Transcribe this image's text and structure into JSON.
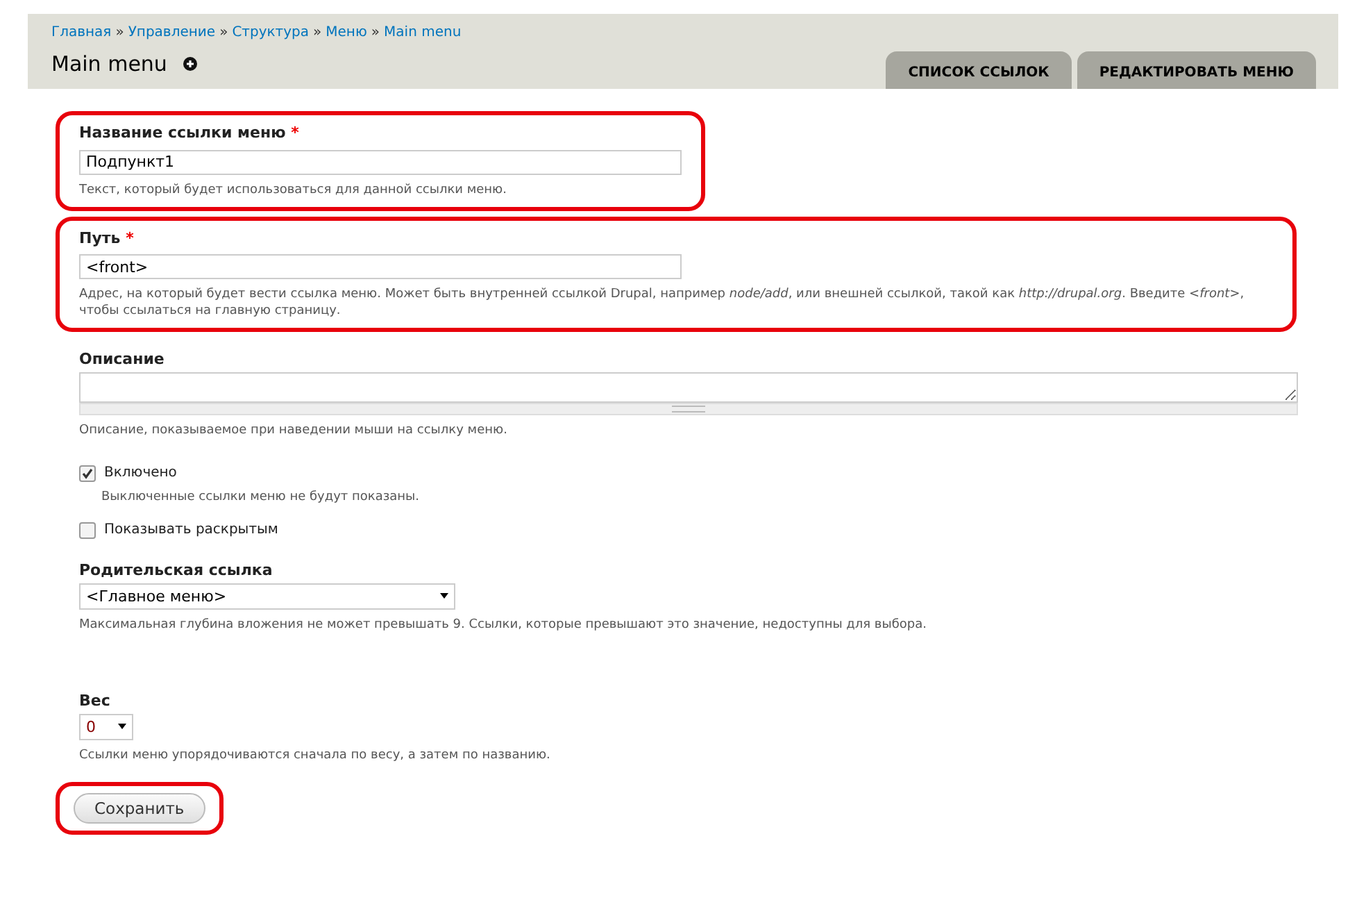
{
  "breadcrumb": [
    "Главная",
    "Управление",
    "Структура",
    "Меню",
    "Main menu"
  ],
  "breadcrumb_separator": "»",
  "page_title": "Main menu",
  "tabs": [
    {
      "label": "СПИСОК ССЫЛОК",
      "selected": false
    },
    {
      "label": "РЕДАКТИРОВАТЬ МЕНЮ",
      "selected": false
    }
  ],
  "fields": [
    {
      "kind": "text",
      "label": "Название ссылки меню",
      "required_mark": "*",
      "value": "Подпункт1",
      "description": "Текст, который будет использоваться для данной ссылки меню.",
      "highlighted": true
    },
    {
      "kind": "text",
      "label": "Путь",
      "required_mark": "*",
      "value": "<front>",
      "description": "Адрес, на который будет вести ссылка меню. Может быть внутренней ссылкой Drupal, например *node/add*, или внешней ссылкой, такой как *http://drupal.org*. Введите *<front>*, чтобы ссылаться на главную страницу.",
      "highlighted": true
    },
    {
      "kind": "textarea",
      "label": "Описание",
      "description": "Описание, показываемое при наведении мыши на ссылку меню.",
      "highlighted": false
    },
    {
      "kind": "checkbox",
      "label": "Включено",
      "checked": true,
      "description": "Выключенные ссылки меню не будут показаны.",
      "highlighted": false
    },
    {
      "kind": "checkbox",
      "label": "Показывать раскрытым",
      "checked": false,
      "highlighted": false
    },
    {
      "kind": "select",
      "label": "Родительская ссылка",
      "value": "<Главное меню>",
      "description": "Максимальная глубина вложения не может превышать 9. Ссылки, которые превышают это значение, недоступны для выбора.",
      "highlighted": false
    },
    {
      "kind": "number_select",
      "label": "Вес",
      "value": "0",
      "description": "Ссылки меню упорядочиваются сначала по весу, а затем по названию.",
      "highlighted": false
    }
  ],
  "submit": {
    "label": "Сохранить",
    "highlighted": true
  }
}
